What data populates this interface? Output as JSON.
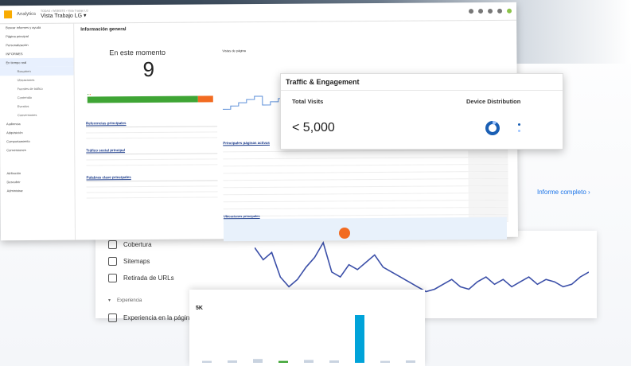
{
  "ga": {
    "brand": "Analytics",
    "crumb": "TODAS › WEBSITE › Vista Trabajo LG",
    "view_name": "Vista Trabajo LG ▾",
    "title": "Información general",
    "realtime": {
      "label": "En este momento",
      "value": "9"
    },
    "sections": {
      "refs": "Referencias principales",
      "social": "Tráfico social principal",
      "keywords": "Palabras clave principales",
      "pageviews": "Vistas de página",
      "top_pages": "Principales páginas activas",
      "events": "Ubicaciones principales"
    },
    "sidebar": [
      {
        "label": "Buscar informes y ayuda",
        "sub": false,
        "selected": false
      },
      {
        "label": "Página principal",
        "sub": false,
        "selected": false
      },
      {
        "label": "Personalización",
        "sub": false,
        "selected": false
      },
      {
        "label": "INFORMES",
        "sub": false,
        "selected": false
      },
      {
        "label": "En tiempo real",
        "sub": false,
        "selected": true
      },
      {
        "label": "Resumen",
        "sub": true,
        "selected": true
      },
      {
        "label": "Ubicaciones",
        "sub": true,
        "selected": false
      },
      {
        "label": "Fuentes de tráfico",
        "sub": true,
        "selected": false
      },
      {
        "label": "Contenido",
        "sub": true,
        "selected": false
      },
      {
        "label": "Eventos",
        "sub": true,
        "selected": false
      },
      {
        "label": "Conversiones",
        "sub": true,
        "selected": false
      },
      {
        "label": "Audiencia",
        "sub": false,
        "selected": false
      },
      {
        "label": "Adquisición",
        "sub": false,
        "selected": false
      },
      {
        "label": "Comportamiento",
        "sub": false,
        "selected": false
      },
      {
        "label": "Conversiones",
        "sub": false,
        "selected": false
      }
    ],
    "sidebar_bottom": [
      {
        "label": "Atribución"
      },
      {
        "label": "Descubrir"
      },
      {
        "label": "Administrar"
      }
    ]
  },
  "search_console": {
    "items": [
      {
        "label": "Cobertura",
        "icon": "document-icon"
      },
      {
        "label": "Sitemaps",
        "icon": "sitemap-icon"
      },
      {
        "label": "Retirada de URLs",
        "icon": "eye-off-icon"
      },
      {
        "label": "Experiencia",
        "icon": "chevron-icon"
      },
      {
        "label": "Experiencia en la página",
        "icon": "gauge-icon"
      }
    ],
    "report_link": "Informe completo",
    "chart_values": [
      120,
      95,
      110,
      60,
      40,
      55,
      80,
      100,
      130,
      70,
      60,
      85,
      75,
      90,
      105,
      80,
      70,
      60,
      50,
      40,
      30,
      35,
      45,
      55,
      40,
      35,
      50,
      60,
      45,
      55,
      40,
      50,
      60,
      45,
      55,
      50,
      40,
      45,
      60,
      70
    ]
  },
  "traffic_engagement": {
    "title": "Traffic & Engagement",
    "total_visits": {
      "label": "Total Visits",
      "value": "< 5,000"
    },
    "device": {
      "label": "Device Distribution"
    }
  },
  "bottom_chart": {
    "value": "5K",
    "bars": [
      0.04,
      0.05,
      0.08,
      0.04,
      0.06,
      0.05,
      1.0,
      0.04,
      0.05
    ],
    "accent": "#00a3d9"
  },
  "colors": {
    "green": "#3fa535",
    "orange": "#f26b21",
    "blue": "#1a73e8"
  }
}
